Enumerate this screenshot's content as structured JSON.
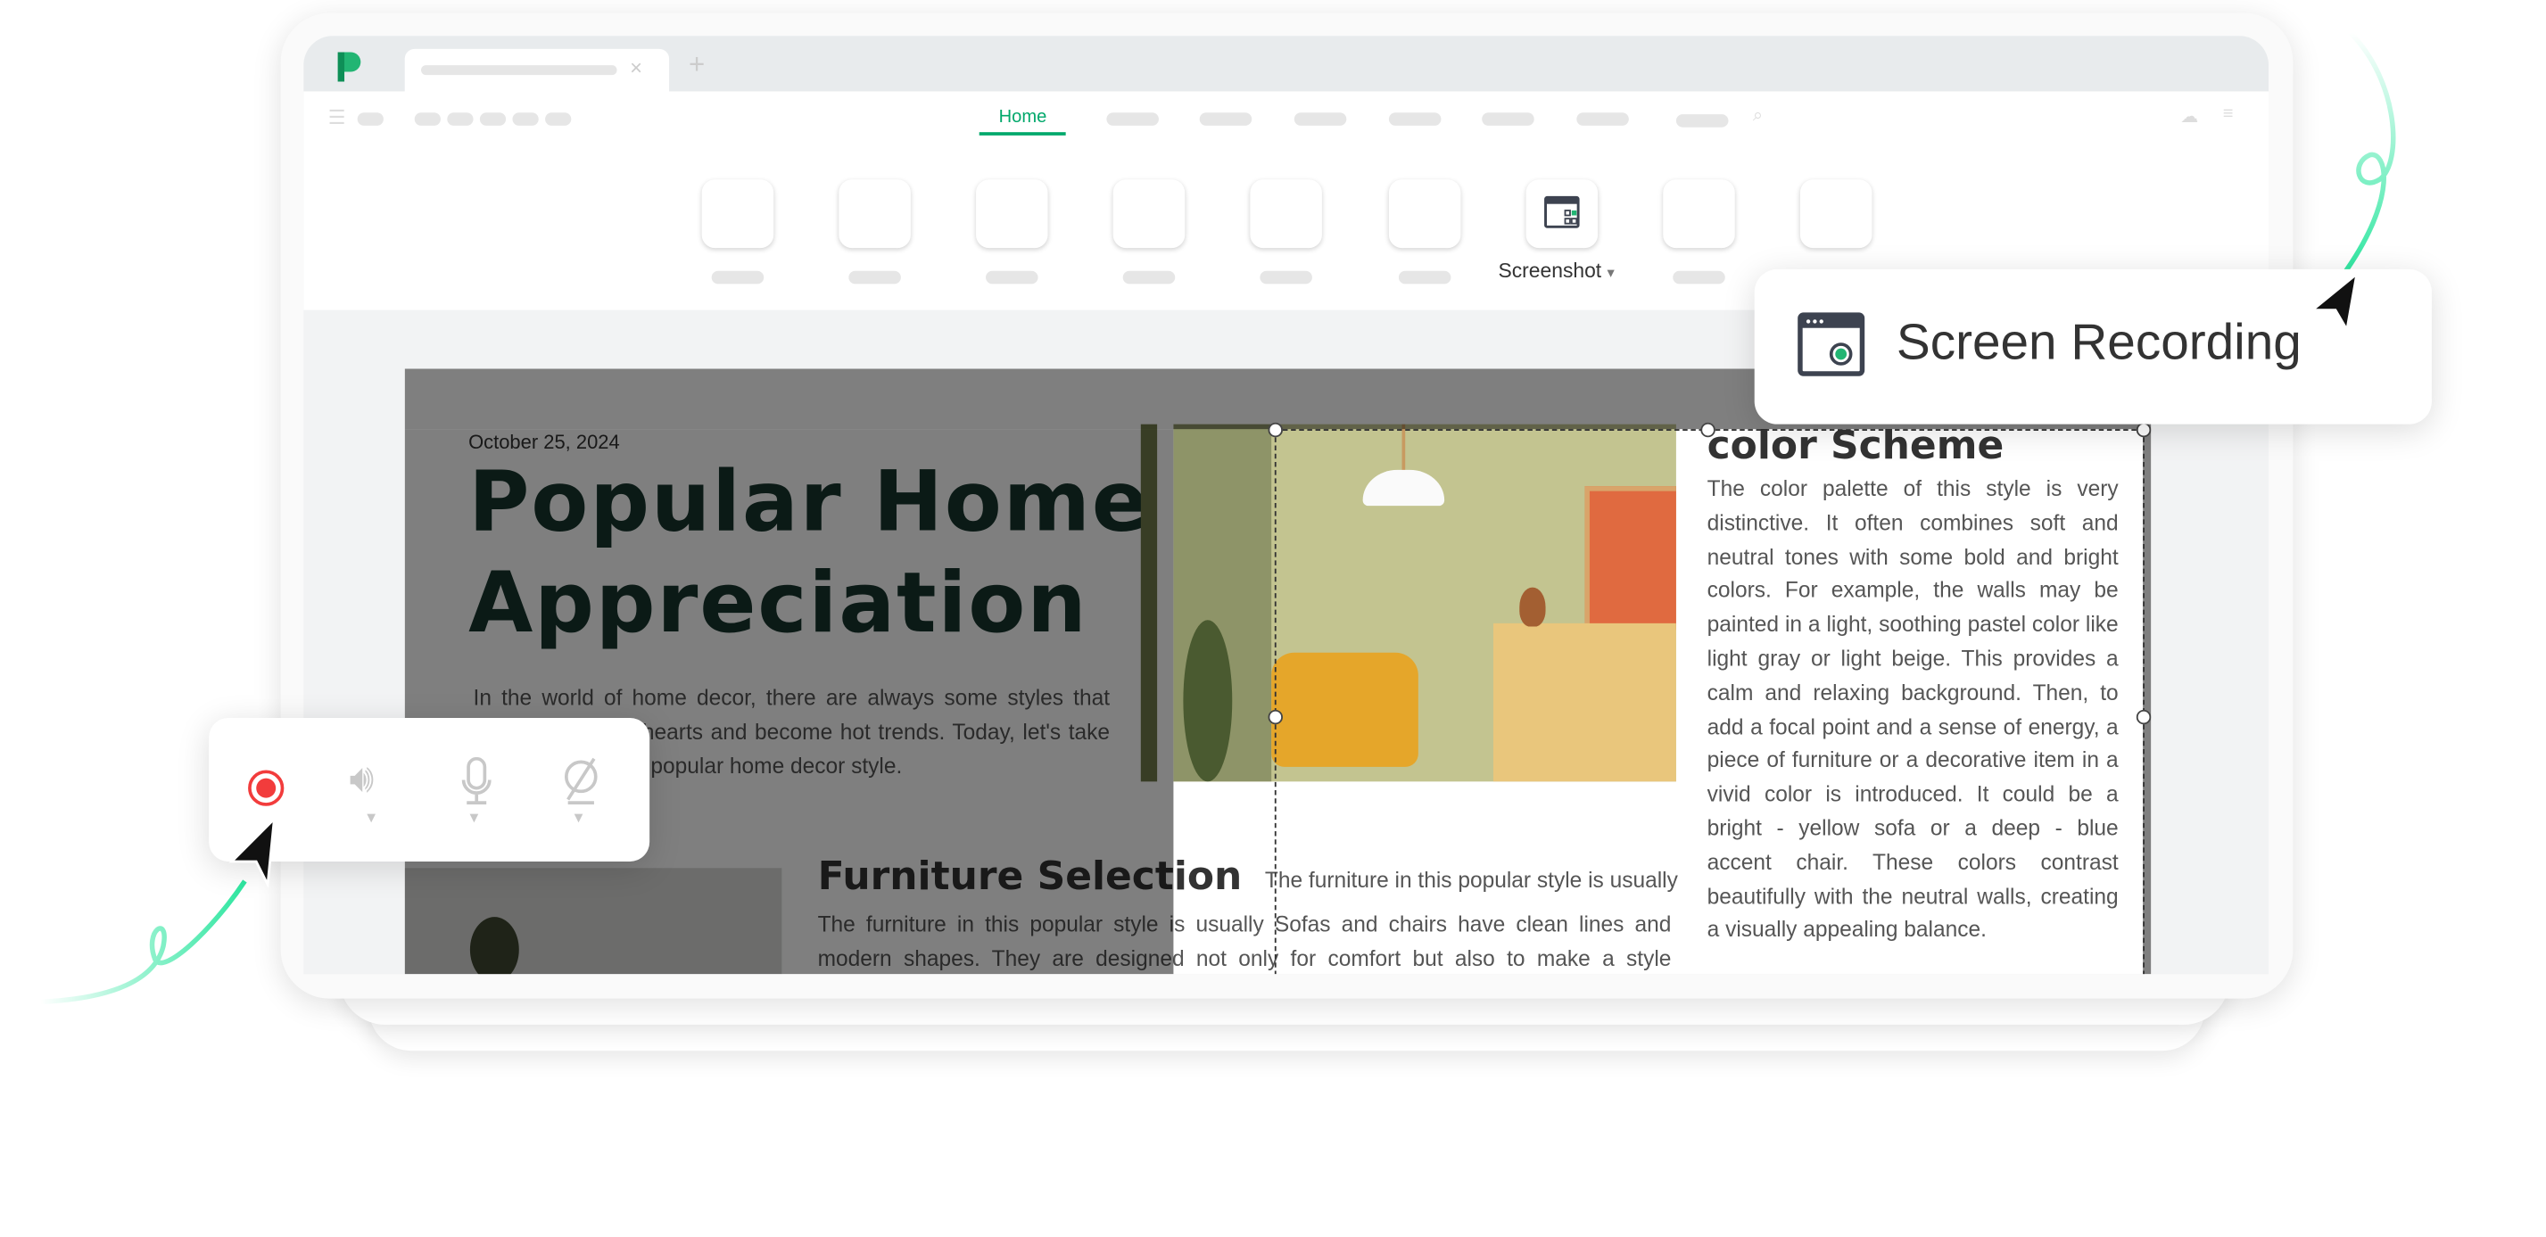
{
  "app": {
    "brand_color": "#22b573",
    "accent": "#00a86b"
  },
  "toolbar": {
    "active_tab": "Home",
    "screenshot_label": "Screenshot",
    "screenshot_arrow": "▾"
  },
  "document": {
    "date": "October 25, 2024",
    "title_line1": "Popular Home",
    "title_line2": "Appreciation",
    "intro": "In the world of home decor, there are always some styles that capture people's hearts and become hot trends. Today, let's take a look at a kind of popular home decor style.",
    "color_scheme_heading": "color Scheme",
    "color_scheme_text": "The color palette of this style is very distinctive. It often combines soft and neutral tones with some bold and bright colors. For example, the walls may be painted in a light, soothing pastel color like light gray or light beige. This provides a calm and relaxing background. Then, to add a focal point and a sense of energy, a piece of furniture or a decorative item in a vivid color is introduced. It could be a bright - yellow sofa or a deep - blue accent chair. These colors contrast beautifully with the neutral walls, creating a visually appealing balance.",
    "furniture_heading": "Furniture Selection",
    "furniture_side": "The furniture in this popular style is usually",
    "furniture_text": "The furniture in this popular style is usually Sofas and chairs have clean lines and modern shapes. They are designed not only for comfort but also to make a style statement. Many of them use materials like leather or high - quality fabric. Coffee tables and side tables"
  },
  "recording_panel": {
    "label": "Screen Recording",
    "icon": "screen-recording-icon"
  },
  "record_toolbar": {
    "record_color": "#f23c3c",
    "icons": [
      "record-icon",
      "speaker-icon",
      "microphone-icon",
      "camera-off-icon"
    ]
  }
}
